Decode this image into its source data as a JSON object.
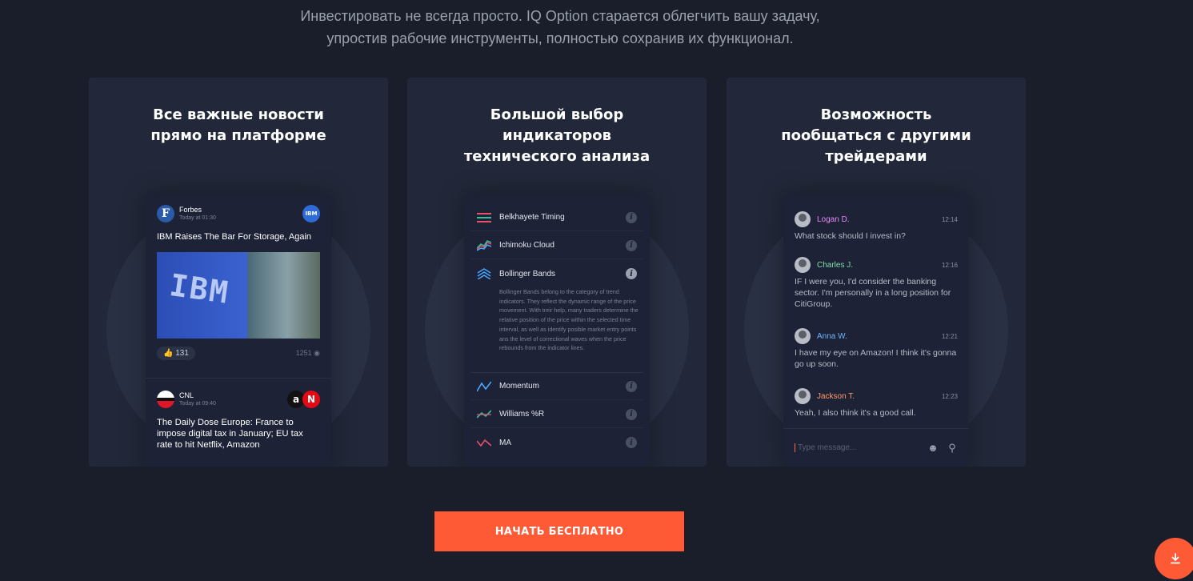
{
  "intro": {
    "line1": "Инвестировать не всегда просто. IQ Option старается облегчить вашу задачу,",
    "line2": "упростив рабочие инструменты, полностью сохранив их функционал."
  },
  "cards": [
    {
      "title_line1": "Все важные новости",
      "title_line2": "прямо на платформе"
    },
    {
      "title_line1": "Большой выбор",
      "title_line2": "индикаторов",
      "title_line3": "технического анализа"
    },
    {
      "title_line1": "Возможность",
      "title_line2": "пообщаться с другими",
      "title_line3": "трейдерами"
    }
  ],
  "news": [
    {
      "source": "Forbes",
      "source_logo": "F",
      "time": "Today at 01:30",
      "ticker_logo": "IBM",
      "title": "IBM Raises The Bar For Storage, Again",
      "image_text": "IBM",
      "likes": "131",
      "views": "1251"
    },
    {
      "source": "CNL",
      "time": "Today at 09:40",
      "ticker_logo_1": "a",
      "ticker_logo_2": "N",
      "title": "The Daily Dose Europe: France to impose digital tax in January; EU tax rate to hit Netflix, Amazon"
    }
  ],
  "indicators": [
    {
      "name": "Belkhayete Timing",
      "icon": "bars-icon"
    },
    {
      "name": "Ichimoku Cloud",
      "icon": "cloud-chart-icon"
    },
    {
      "name": "Bollinger Bands",
      "icon": "chevrons-icon"
    },
    {
      "name": "Momentum",
      "icon": "momentum-line-icon"
    },
    {
      "name": "Williams %R",
      "icon": "williams-icon"
    },
    {
      "name": "MA",
      "icon": "ma-line-icon"
    }
  ],
  "indicator_description": "Bollinger Bands belong to the category of trend indicators. They reflect the dynamic range of the price movement. With treir help, many traders determine the relative position of the price within the selected time interval, as well as identify posible market entry points ans the level of correctional waves when the price rebounds from the indicator lines.",
  "chat": {
    "messages": [
      {
        "name": "Logan D.",
        "time": "12:14",
        "text": "What stock should I invest in?",
        "color": "#e48bf5"
      },
      {
        "name": "Charles J.",
        "time": "12:16",
        "text": "IF I were you, I'd consider the banking sector. I'm personally in a long position for CitiGroup.",
        "color": "#7fe0a8"
      },
      {
        "name": "Anna W.",
        "time": "12:21",
        "text": "I have my eye on Amazon! I think it's gonna go up soon.",
        "color": "#6fb6ff"
      },
      {
        "name": "Jackson T.",
        "time": "12:23",
        "text": "Yeah, I also think it's a good call.",
        "color": "#ff9a6a"
      }
    ],
    "input_placeholder": "Type message..."
  },
  "cta_label": "НАЧАТЬ БЕСПЛАТНО",
  "colors": {
    "accent": "#ff5a36",
    "card_bg": "#222839",
    "page_bg": "#1a1e2a"
  }
}
